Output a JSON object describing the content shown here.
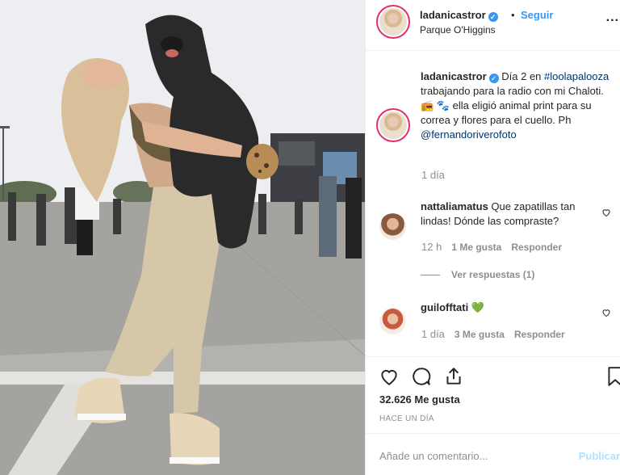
{
  "post": {
    "author": "ladanicastror",
    "follow_label": "Seguir",
    "separator": "•",
    "location": "Parque O'Higgins",
    "more_label": "...",
    "caption": {
      "username": "ladanicastror",
      "text_1": " Día 2 en ",
      "hashtag": "#loolapalooza",
      "text_2": " trabajando para la radio con mi Chaloti. 📻 🐾 ella eligió animal print para su correa y flores para el cuello. Ph ",
      "mention": "@fernandoriverofoto"
    },
    "caption_time": "1 día",
    "likes": "32.626 Me gusta",
    "posted": "HACE UN DÍA",
    "add_comment_placeholder": "Añade un comentario...",
    "publish_label": "Publicar"
  },
  "comments": [
    {
      "username": "nattaliamatus",
      "text": " Que zapatillas tan lindas! Dónde las compraste?",
      "time": "12 h",
      "likes": "1 Me gusta",
      "reply_label": "Responder"
    },
    {
      "username": "guilofftati",
      "text": " 💚",
      "time": "1 día",
      "likes": "3 Me gusta",
      "reply_label": "Responder"
    }
  ],
  "view_replies": "Ver respuestas (1)",
  "colors": {
    "accent": "#3897f0",
    "link": "#003569",
    "muted": "#8e8e8e",
    "ring": "#e1306c",
    "publish_disabled": "#b2dffc"
  },
  "icons": [
    "verified-icon",
    "more-icon",
    "heart-icon",
    "comment-icon",
    "share-icon",
    "bookmark-icon"
  ]
}
